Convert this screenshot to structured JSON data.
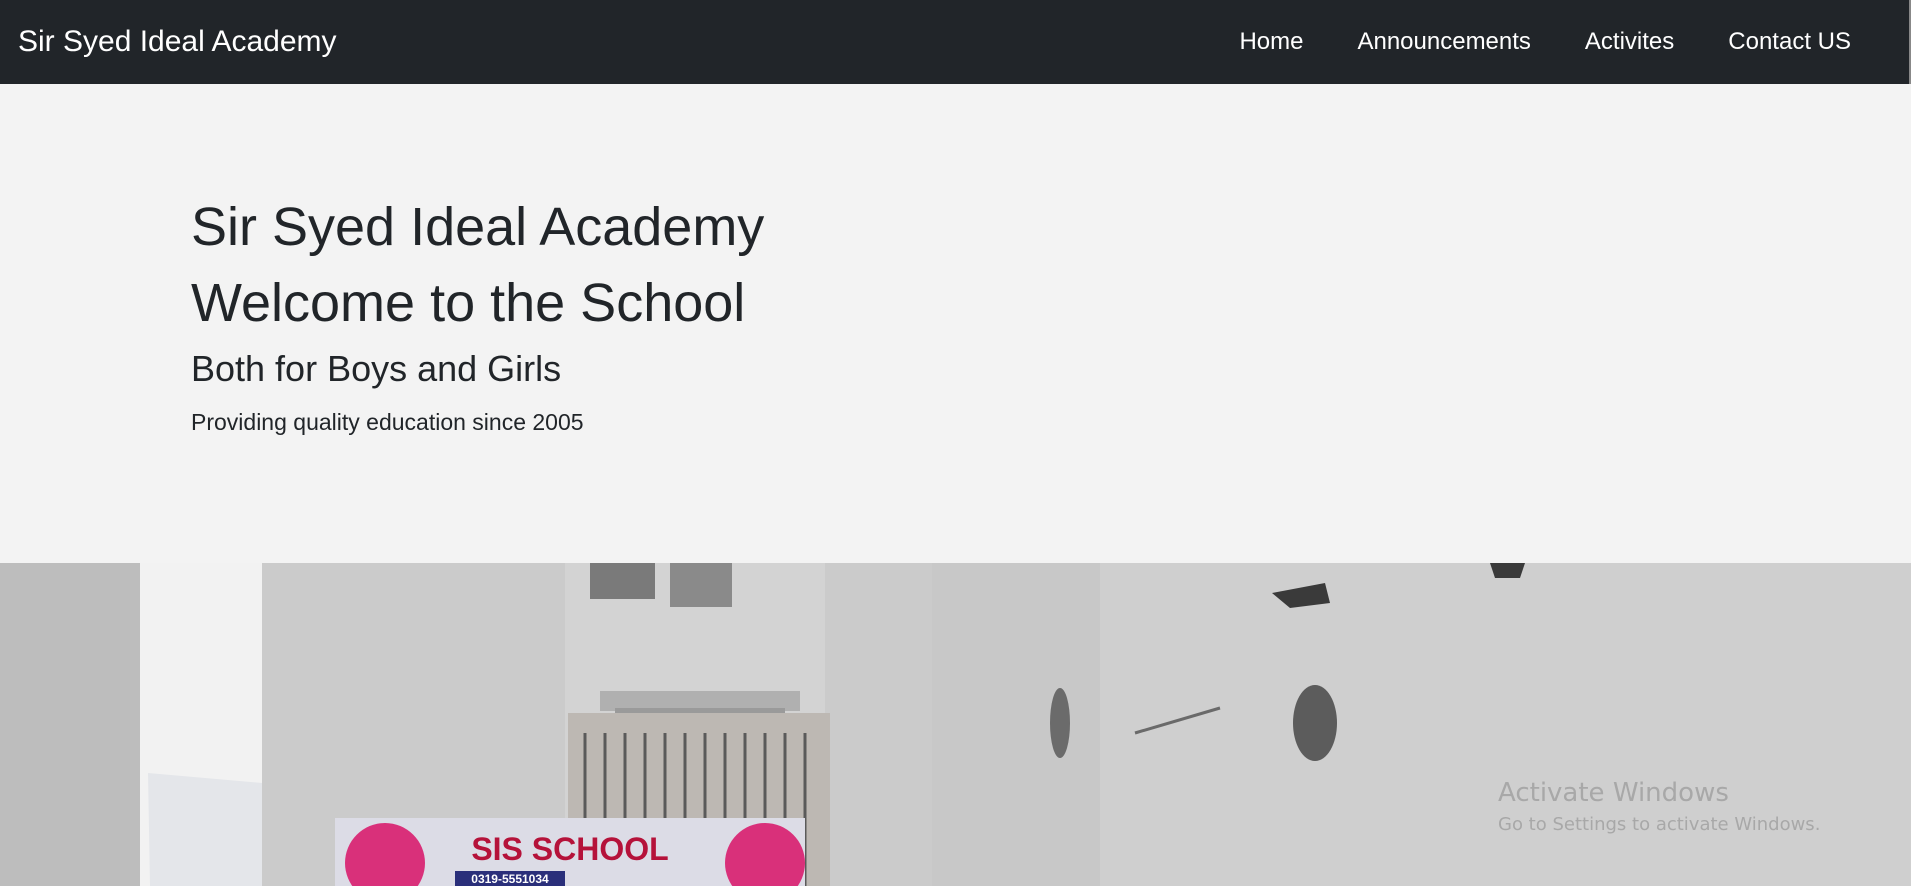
{
  "navbar": {
    "brand": "Sir Syed Ideal Academy",
    "links": [
      {
        "label": "Home"
      },
      {
        "label": "Announcements"
      },
      {
        "label": "Activites"
      },
      {
        "label": "Contact US"
      }
    ]
  },
  "hero": {
    "title": "Sir Syed Ideal Academy",
    "subtitle": "Welcome to the School",
    "tagline": "Both for Boys and Girls",
    "description": "Providing quality education since 2005"
  },
  "photo": {
    "banner_text": "SIS SCHOOL",
    "banner_phone": "0319-5551034"
  },
  "watermark": {
    "title": "Activate Windows",
    "subtitle": "Go to Settings to activate Windows."
  },
  "colors": {
    "navbar_bg": "#212529",
    "hero_bg": "#f3f3f3",
    "text": "#212529"
  }
}
